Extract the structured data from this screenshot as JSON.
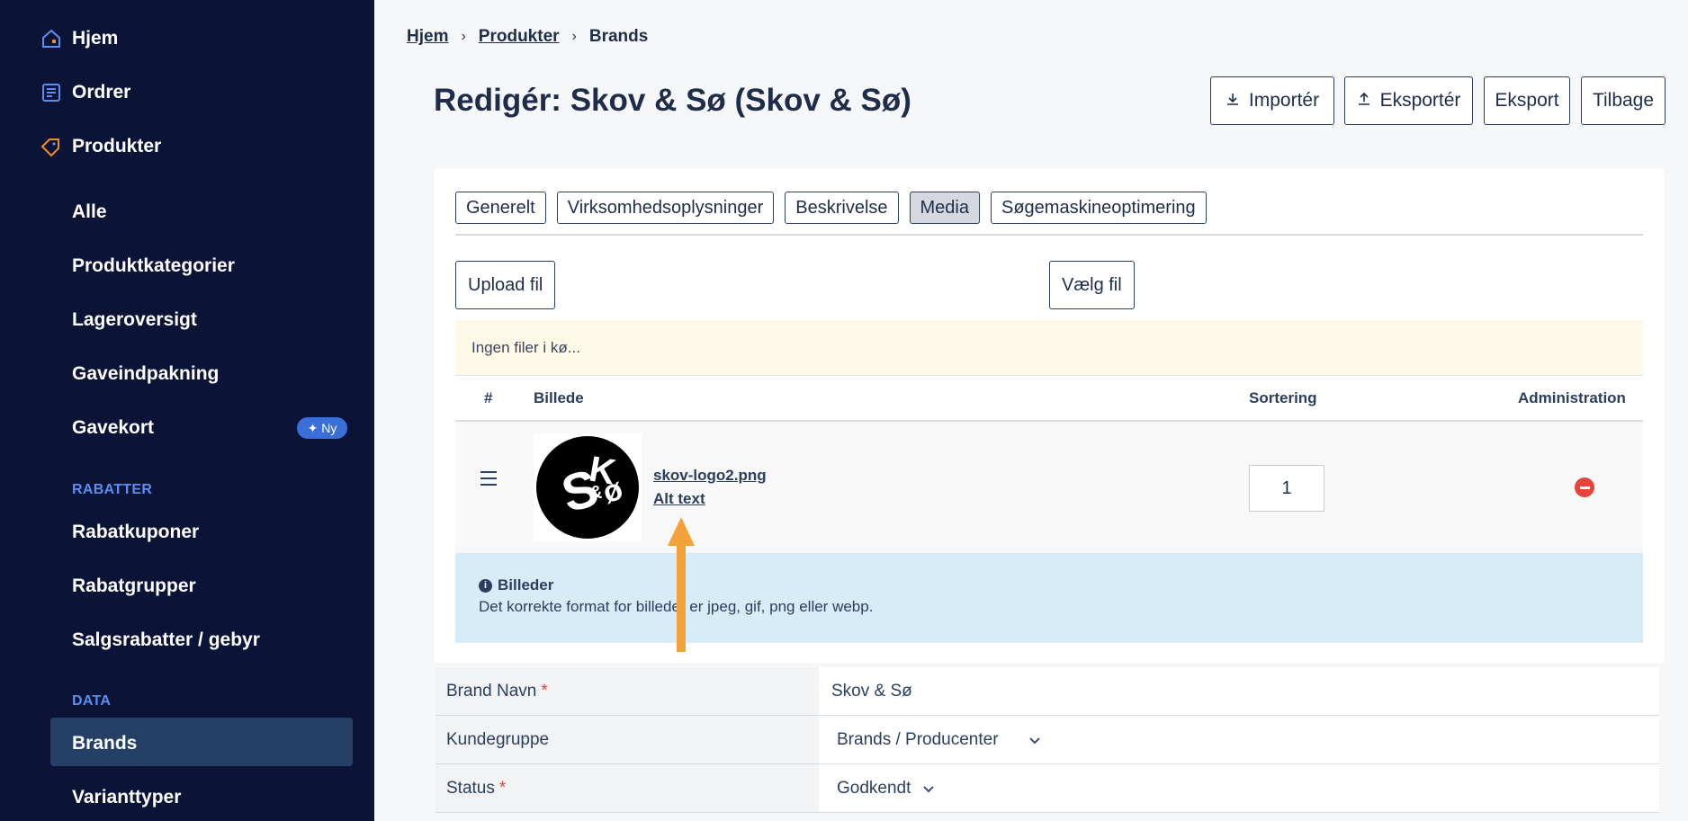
{
  "sidebar": {
    "items": [
      {
        "label": "Hjem",
        "icon": "home-icon"
      },
      {
        "label": "Ordrer",
        "icon": "orders-icon"
      },
      {
        "label": "Produkter",
        "icon": "tag-icon"
      }
    ],
    "sub_items_top": [
      "Alle",
      "Produktkategorier",
      "Lageroversigt",
      "Gaveindpakning",
      "Gavekort"
    ],
    "badge_new": "Ny",
    "section_rabatter": "RABATTER",
    "sub_items_rabatter": [
      "Rabatkuponer",
      "Rabatgrupper",
      "Salgsrabatter / gebyr"
    ],
    "section_data": "DATA",
    "sub_items_data": [
      "Brands",
      "Varianttyper"
    ],
    "active_item": "Brands",
    "colors": {
      "bg": "#0b1437",
      "active": "#244066",
      "section": "#5b8ef0",
      "accent": "#f28c28"
    }
  },
  "breadcrumb": {
    "home": "Hjem",
    "products": "Produkter",
    "current": "Brands"
  },
  "page": {
    "title": "Redigér: Skov & Sø (Skov & Sø)"
  },
  "toolbar": {
    "import": "Importér",
    "export": "Eksportér",
    "export2": "Eksport",
    "back": "Tilbage"
  },
  "tabs": [
    "Generelt",
    "Virksomhedsoplysninger",
    "Beskrivelse",
    "Media",
    "Søgemaskineoptimering"
  ],
  "active_tab": "Media",
  "media": {
    "upload_label": "Upload fil",
    "choose_label": "Vælg fil",
    "queue_text": "Ingen filer i kø...",
    "columns": {
      "num": "#",
      "image": "Billede",
      "sort": "Sortering",
      "admin": "Administration"
    },
    "row": {
      "file_name": "skov-logo2.png",
      "alt_text": "Alt text",
      "sort": "1"
    },
    "info_title": "Billeder",
    "info_text": "Det korrekte format for billeder er jpeg, gif, png eller webp."
  },
  "form": [
    {
      "label": "Brand Navn",
      "required": "*",
      "value": "Skov & Sø"
    },
    {
      "label": "Kundegruppe",
      "required": "",
      "value": "Brands / Producenter"
    },
    {
      "label": "Status",
      "required": "*",
      "value": "Godkendt"
    }
  ]
}
